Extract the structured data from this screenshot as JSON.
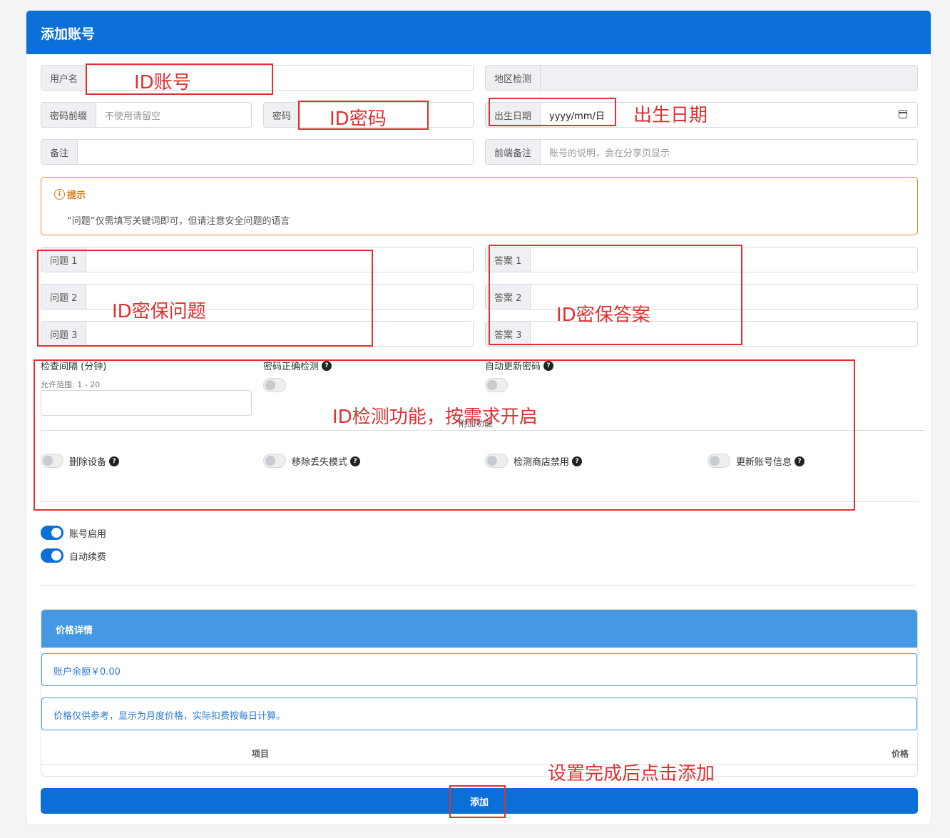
{
  "header": {
    "title": "添加账号"
  },
  "fields": {
    "username": {
      "label": "用户名",
      "value": ""
    },
    "region": {
      "label": "地区检测",
      "value": ""
    },
    "password_prefix": {
      "label": "密码前缀",
      "placeholder": "不使用请留空"
    },
    "password": {
      "label": "密码",
      "value": ""
    },
    "birthday": {
      "label": "出生日期",
      "value": "yyyy/mm/日"
    },
    "remark": {
      "label": "备注",
      "value": ""
    },
    "front_remark": {
      "label": "前端备注",
      "placeholder": "账号的说明，会在分享页显示"
    }
  },
  "notice": {
    "title": "提示",
    "text": "“问题”仅需填写关键词即可，但请注意安全问题的语言"
  },
  "questions": [
    {
      "label": "问题 1",
      "value": ""
    },
    {
      "label": "问题 2",
      "value": ""
    },
    {
      "label": "问题 3",
      "value": ""
    }
  ],
  "answers": [
    {
      "label": "答案 1",
      "value": ""
    },
    {
      "label": "答案 2",
      "value": ""
    },
    {
      "label": "答案 3",
      "value": ""
    }
  ],
  "check": {
    "interval_label": "检查间隔 (分钟)",
    "interval_hint": "允许范围: 1 - 20",
    "interval_value": "",
    "password_check": {
      "label": "密码正确检测",
      "on": false
    },
    "auto_update": {
      "label": "自动更新密码",
      "on": false
    }
  },
  "addon": {
    "title": "附加功能",
    "items": [
      {
        "label": "删除设备",
        "on": false
      },
      {
        "label": "移除丢失模式",
        "on": false
      },
      {
        "label": "检测商店禁用",
        "on": false
      },
      {
        "label": "更新账号信息",
        "on": false
      }
    ]
  },
  "switches": [
    {
      "label": "账号启用",
      "on": true
    },
    {
      "label": "自动续费",
      "on": true
    }
  ],
  "price": {
    "title": "价格详情",
    "balance": "账户余额￥0.00",
    "note": "价格仅供参考，显示为月度价格，实际扣费按每日计算。",
    "columns": [
      "项目",
      "价格"
    ]
  },
  "submit_label": "添加",
  "annotations": {
    "id_account": "ID账号",
    "id_password": "ID密码",
    "birthday": "出生日期",
    "security_question": "ID密保问题",
    "security_answer": "ID密保答案",
    "check_feature": "ID检测功能，按需求开启",
    "submit_hint": "设置完成后点击添加"
  },
  "colors": {
    "primary": "#0a6fd6",
    "price_header": "#4499e2",
    "warning": "#e07a10",
    "annotation": "#e03030"
  }
}
